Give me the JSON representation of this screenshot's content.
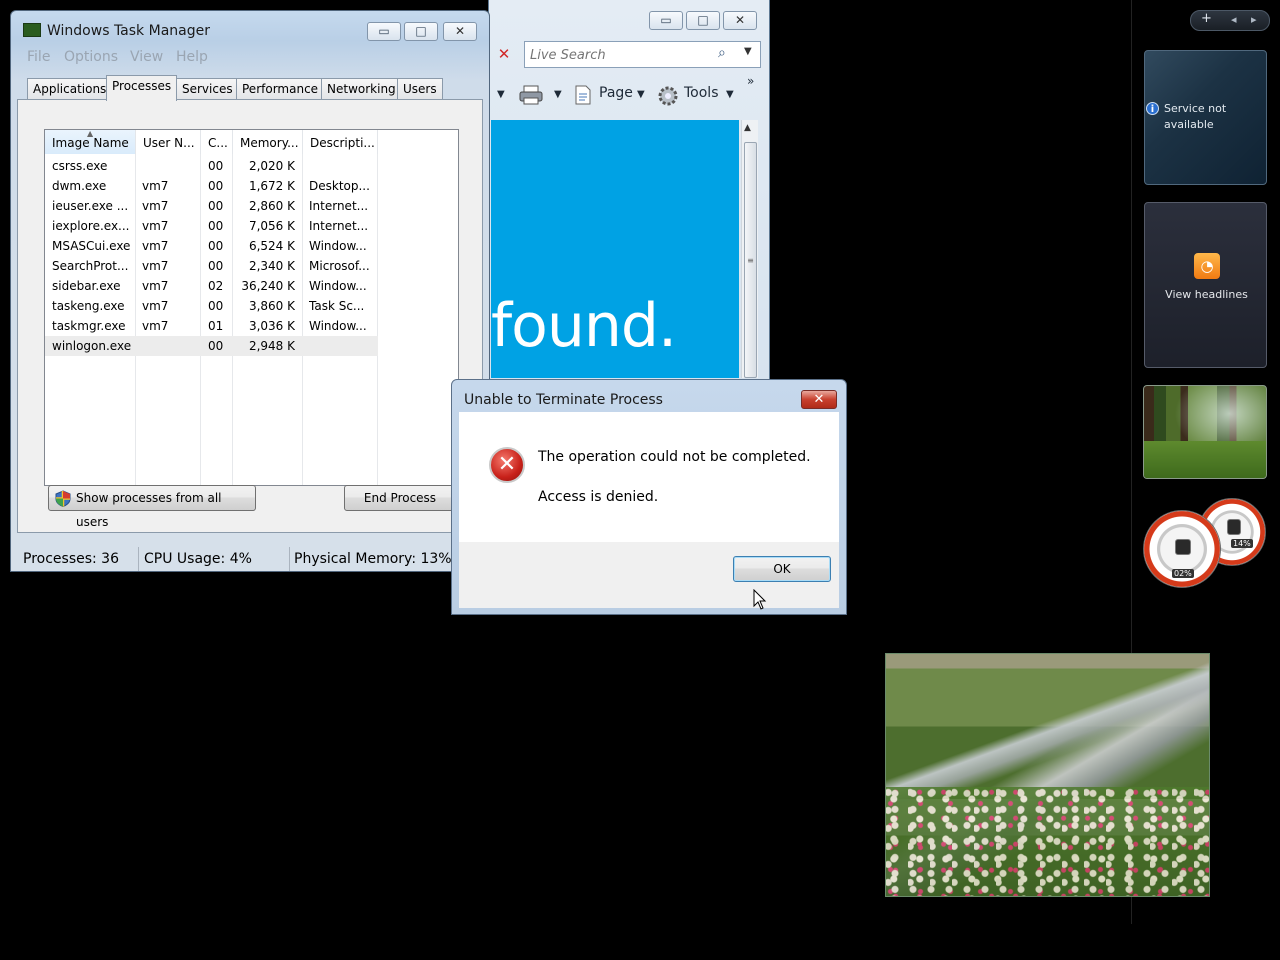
{
  "ie": {
    "search_placeholder": "Live Search",
    "stop_glyph": "✕",
    "search_glyph": "⌕",
    "dropdown_glyph": "▼",
    "page_label": "Page",
    "tools_label": "Tools",
    "more_glyph": "»",
    "content_text": "found.",
    "min_glyph": "▭",
    "max_glyph": "□",
    "close_glyph": "✕"
  },
  "task_manager": {
    "title": "Windows Task Manager",
    "min_glyph": "▭",
    "max_glyph": "□",
    "close_glyph": "✕",
    "menu": [
      "File",
      "Options",
      "View",
      "Help"
    ],
    "tabs": [
      "Applications",
      "Processes",
      "Services",
      "Performance",
      "Networking",
      "Users"
    ],
    "active_tab": "Processes",
    "columns": [
      "Image Name",
      "User N...",
      "C...",
      "Memory...",
      "Descripti..."
    ],
    "processes": [
      {
        "name": "csrss.exe",
        "user": "",
        "cpu": "00",
        "mem": "2,020 K",
        "desc": ""
      },
      {
        "name": "dwm.exe",
        "user": "vm7",
        "cpu": "00",
        "mem": "1,672 K",
        "desc": "Desktop..."
      },
      {
        "name": "ieuser.exe ...",
        "user": "vm7",
        "cpu": "00",
        "mem": "2,860 K",
        "desc": "Internet..."
      },
      {
        "name": "iexplore.ex...",
        "user": "vm7",
        "cpu": "00",
        "mem": "7,056 K",
        "desc": "Internet..."
      },
      {
        "name": "MSASCui.exe",
        "user": "vm7",
        "cpu": "00",
        "mem": "6,524 K",
        "desc": "Window..."
      },
      {
        "name": "SearchProt...",
        "user": "vm7",
        "cpu": "00",
        "mem": "2,340 K",
        "desc": "Microsof..."
      },
      {
        "name": "sidebar.exe",
        "user": "vm7",
        "cpu": "02",
        "mem": "36,240 K",
        "desc": "Window..."
      },
      {
        "name": "taskeng.exe",
        "user": "vm7",
        "cpu": "00",
        "mem": "3,860 K",
        "desc": "Task Sc..."
      },
      {
        "name": "taskmgr.exe",
        "user": "vm7",
        "cpu": "01",
        "mem": "3,036 K",
        "desc": "Window..."
      },
      {
        "name": "winlogon.exe",
        "user": "",
        "cpu": "00",
        "mem": "2,948 K",
        "desc": ""
      }
    ],
    "selected_row": 9,
    "show_all_label": "Show processes from all users",
    "end_process_label": "End Process",
    "status": {
      "processes": "Processes: 36",
      "cpu": "CPU Usage: 4%",
      "memory": "Physical Memory: 13%"
    }
  },
  "dialog": {
    "title": "Unable to Terminate Process",
    "close_glyph": "✕",
    "error_glyph": "✕",
    "message": "The operation could not be completed.",
    "detail": "Access is denied.",
    "ok_label": "OK"
  },
  "sidebar": {
    "add_glyph": "+",
    "prev_glyph": "◂",
    "next_glyph": "▸",
    "weather_info_glyph": "i",
    "weather_text": "Service not available",
    "feeds_glyph": "◔",
    "feeds_text": "View headlines",
    "meter_cpu": "02%",
    "meter_mem": "14%"
  },
  "colors": {
    "ie_content_bg": "#00a2e4",
    "desktop_bg": "#000000",
    "dialog_close": "#c8402e"
  }
}
